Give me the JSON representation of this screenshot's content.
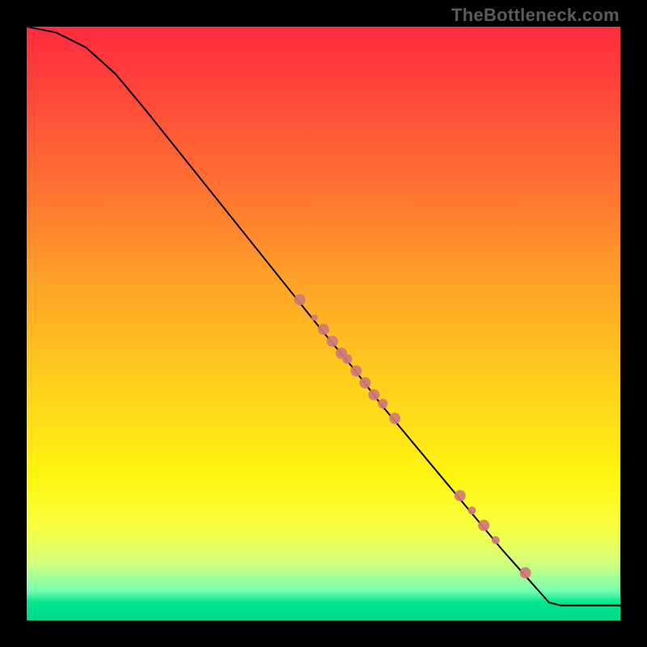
{
  "watermark": "TheBottleneck.com",
  "colors": {
    "curve": "#000000",
    "marker_fill": "#d07a78",
    "marker_stroke": "#a85a58"
  },
  "chart_data": {
    "type": "line",
    "title": "",
    "xlabel": "",
    "ylabel": "",
    "xlim": [
      0,
      100
    ],
    "ylim": [
      0,
      100
    ],
    "curve": [
      {
        "x": 0,
        "y": 100
      },
      {
        "x": 5,
        "y": 99
      },
      {
        "x": 10,
        "y": 96.5
      },
      {
        "x": 15,
        "y": 92
      },
      {
        "x": 20,
        "y": 86
      },
      {
        "x": 30,
        "y": 73.5
      },
      {
        "x": 40,
        "y": 61
      },
      {
        "x": 50,
        "y": 48.5
      },
      {
        "x": 55,
        "y": 42.5
      },
      {
        "x": 60,
        "y": 36
      },
      {
        "x": 70,
        "y": 24
      },
      {
        "x": 80,
        "y": 12
      },
      {
        "x": 88,
        "y": 3
      },
      {
        "x": 90,
        "y": 2.5
      },
      {
        "x": 100,
        "y": 2.5
      }
    ],
    "markers": [
      {
        "x": 46,
        "y": 54,
        "r": 7
      },
      {
        "x": 48.5,
        "y": 51,
        "r": 4
      },
      {
        "x": 50,
        "y": 49,
        "r": 7
      },
      {
        "x": 51.5,
        "y": 47,
        "r": 7
      },
      {
        "x": 53,
        "y": 45,
        "r": 7
      },
      {
        "x": 54,
        "y": 44,
        "r": 6
      },
      {
        "x": 55.5,
        "y": 42,
        "r": 7
      },
      {
        "x": 57,
        "y": 40,
        "r": 7
      },
      {
        "x": 58.5,
        "y": 38,
        "r": 7
      },
      {
        "x": 60,
        "y": 36.5,
        "r": 6
      },
      {
        "x": 62,
        "y": 34,
        "r": 7
      },
      {
        "x": 73,
        "y": 21,
        "r": 7
      },
      {
        "x": 75,
        "y": 18.5,
        "r": 5
      },
      {
        "x": 77,
        "y": 16,
        "r": 7
      },
      {
        "x": 79,
        "y": 13.5,
        "r": 5
      },
      {
        "x": 84,
        "y": 8,
        "r": 7
      }
    ]
  }
}
